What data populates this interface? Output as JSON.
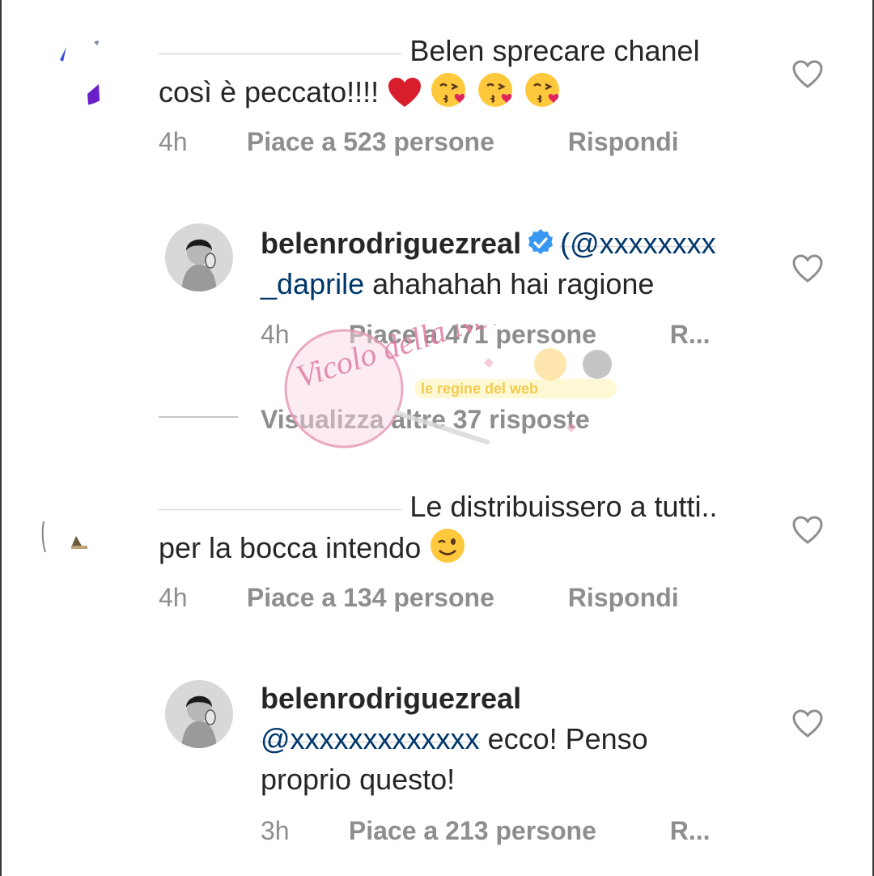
{
  "comments": [
    {
      "username": "",
      "text": "Belen sprecare chanel così è peccato!!!!",
      "emojis": [
        "red-heart",
        "kiss-face",
        "kiss-face",
        "kiss-face"
      ],
      "time": "4h",
      "likes": "Piace a 523 persone",
      "reply": "Rispondi"
    },
    {
      "username": "belenrodriguezreal",
      "verified": true,
      "mention": "_daprile",
      "text": "ahahahah hai ragione",
      "time": "4h",
      "likes": "Piace a 471 persone",
      "reply": "R..."
    },
    {
      "view_more": "Visualizza altre 37 risposte"
    },
    {
      "username": "",
      "text": "Le distribuissero a tutti.. per la bocca intendo",
      "emojis": [
        "wink-face"
      ],
      "time": "4h",
      "likes": "Piace a 134 persone",
      "reply": "Rispondi"
    },
    {
      "username": "belenrodriguezreal",
      "text": "ecco! Penso proprio questo!",
      "time": "3h",
      "likes": "Piace a 213 persone",
      "reply": "R..."
    }
  ],
  "watermark": {
    "logo_text": "Vicolo della News",
    "banner_text": "le regine del web"
  },
  "colors": {
    "text": "#262626",
    "meta": "#8e8e8e",
    "mention": "#00376b",
    "verified": "#3897f0"
  }
}
